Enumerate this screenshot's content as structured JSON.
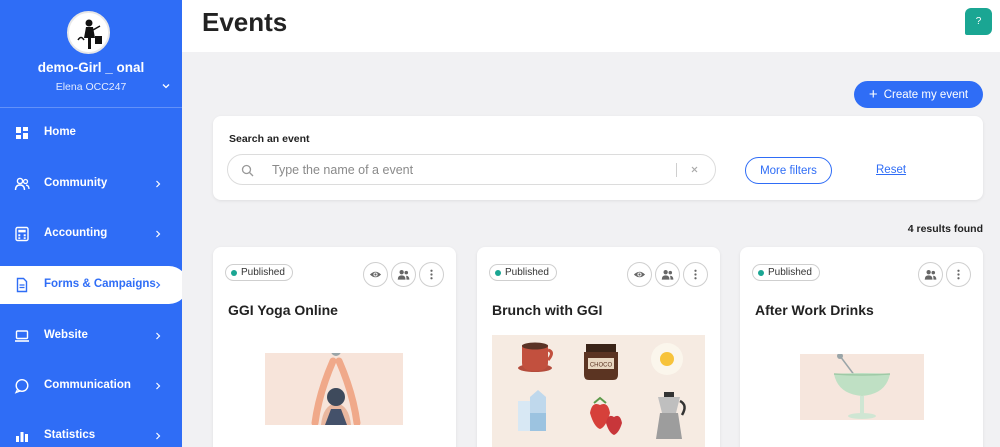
{
  "sidebar": {
    "org_name": "demo-Girl _ onal",
    "user_name": "Elena OCC247",
    "items": [
      {
        "label": "Home",
        "icon": "dashboard-icon"
      },
      {
        "label": "Community",
        "icon": "people-icon"
      },
      {
        "label": "Accounting",
        "icon": "calculator-icon"
      },
      {
        "label": "Forms & Campaigns",
        "icon": "document-icon",
        "active": true
      },
      {
        "label": "Website",
        "icon": "laptop-icon"
      },
      {
        "label": "Communication",
        "icon": "chat-icon"
      },
      {
        "label": "Statistics",
        "icon": "chart-icon"
      }
    ]
  },
  "header": {
    "title": "Events",
    "help_label": "?"
  },
  "toolbar": {
    "create_label": "Create my event",
    "create_icon": "plus-icon"
  },
  "search": {
    "label": "Search an event",
    "placeholder": "Type the name of a event",
    "value": "",
    "more_filters_label": "More filters",
    "reset_label": "Reset"
  },
  "results_text": "4 results found",
  "events": [
    {
      "status": "Published",
      "title": "GGI Yoga Online",
      "actions": [
        "eye-icon",
        "people-icon",
        "more-vertical-icon"
      ]
    },
    {
      "status": "Published",
      "title": "Brunch with GGI",
      "image_text": "CHOCO",
      "actions": [
        "eye-icon",
        "people-icon",
        "more-vertical-icon"
      ]
    },
    {
      "status": "Published",
      "title": "After Work Drinks",
      "actions": [
        "people-icon",
        "more-vertical-icon"
      ]
    }
  ],
  "colors": {
    "brand": "#2f6df6",
    "status_published": "#1aa693",
    "help": "#1aa693"
  }
}
